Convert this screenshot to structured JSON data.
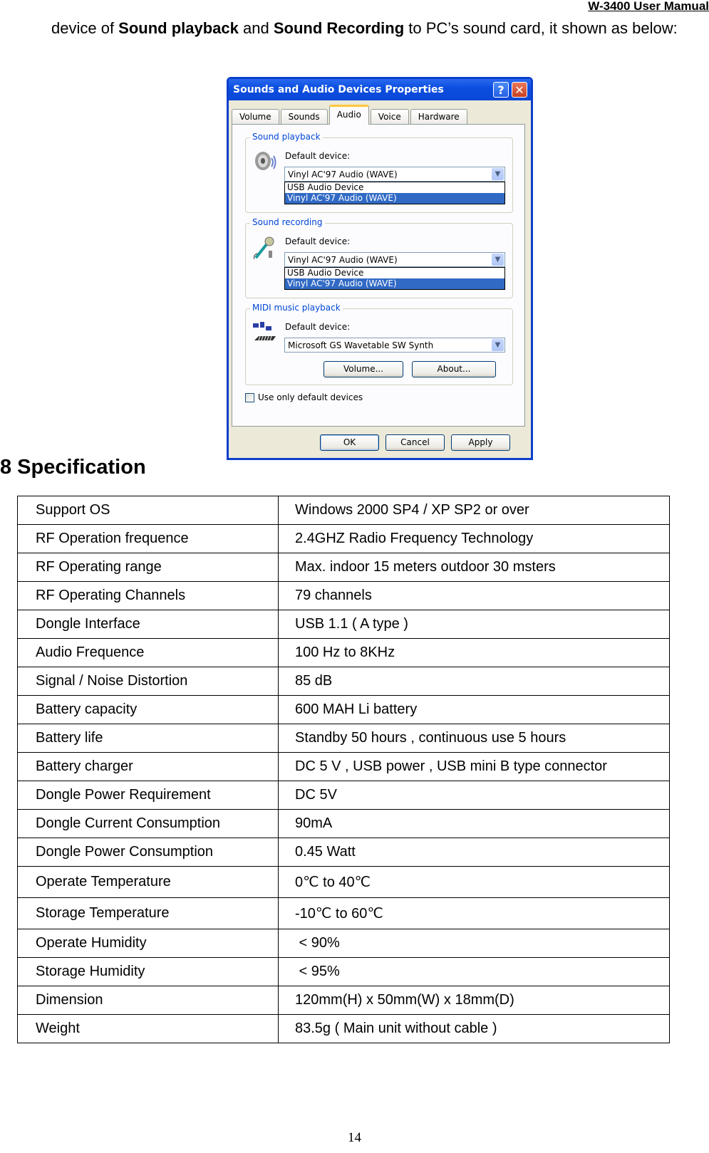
{
  "header": {
    "title": "W-3400 User Mamual"
  },
  "intro": {
    "prefix": "device of ",
    "bold1": "Sound playback",
    "mid": " and ",
    "bold2": "Sound Recording",
    "suffix": " to PC’s sound card, it shown as below:"
  },
  "dialog": {
    "title": "Sounds and Audio Devices Properties",
    "help_label": "?",
    "close_label": "✕",
    "tabs": [
      {
        "label": "Volume",
        "active": false
      },
      {
        "label": "Sounds",
        "active": false
      },
      {
        "label": "Audio",
        "active": true
      },
      {
        "label": "Voice",
        "active": false
      },
      {
        "label": "Hardware",
        "active": false
      }
    ],
    "groups": [
      {
        "legend": "Sound playback",
        "icon": "speaker-icon",
        "label": "Default device:",
        "selected": "Vinyl AC'97 Audio (WAVE)",
        "options": [
          "USB Audio Device",
          "Vinyl AC'97 Audio (WAVE)"
        ],
        "highlighted_option": "Vinyl AC'97 Audio (WAVE)"
      },
      {
        "legend": "Sound recording",
        "icon": "microphone-icon",
        "label": "Default device:",
        "selected": "Vinyl AC'97 Audio (WAVE)",
        "options": [
          "USB Audio Device",
          "Vinyl AC'97 Audio (WAVE)"
        ],
        "highlighted_option": "Vinyl AC'97 Audio (WAVE)"
      },
      {
        "legend": "MIDI music playback",
        "icon": "midi-keyboard-icon",
        "label": "Default device:",
        "selected": "Microsoft GS Wavetable SW Synth",
        "volume_button": "Volume...",
        "about_button": "About..."
      }
    ],
    "checkbox_label": "Use only default devices",
    "checkbox_checked": false,
    "ok_label": "OK",
    "cancel_label": "Cancel",
    "apply_label": "Apply"
  },
  "spec": {
    "heading": "8 Specification",
    "rows": [
      {
        "key": "Support OS",
        "value": "Windows 2000 SP4 / XP SP2 or over"
      },
      {
        "key": "RF Operation frequence",
        "value": "2.4GHZ Radio Frequency Technology"
      },
      {
        "key": "RF Operating range",
        "value": "Max. indoor 15 meters outdoor 30 msters"
      },
      {
        "key": "RF Operating Channels",
        "value": "79 channels"
      },
      {
        "key": "Dongle Interface",
        "value": "USB 1.1 ( A type )"
      },
      {
        "key": "Audio Frequence",
        "value": "100 Hz to 8KHz"
      },
      {
        "key": "Signal / Noise Distortion",
        "value": "85 dB"
      },
      {
        "key": "Battery capacity",
        "value": "600 MAH Li battery"
      },
      {
        "key": "Battery life",
        "value": "Standby 50 hours , continuous use 5 hours"
      },
      {
        "key": "Battery charger",
        "value": "DC 5 V , USB power , USB mini B type connector"
      },
      {
        "key": "Dongle Power Requirement",
        "value": "DC 5V"
      },
      {
        "key": "Dongle Current Consumption",
        "value": "90mA"
      },
      {
        "key": "Dongle Power Consumption",
        "value": "0.45 Watt"
      },
      {
        "key": "Operate Temperature",
        "value": "0℃ to 40℃"
      },
      {
        "key": "Storage Temperature",
        "value": "-10℃ to 60℃"
      },
      {
        "key": "Operate Humidity",
        "value": " < 90%"
      },
      {
        "key": "Storage Humidity",
        "value": " < 95%"
      },
      {
        "key": "Dimension",
        "value": "120mm(H) x 50mm(W) x 18mm(D)"
      },
      {
        "key": "Weight",
        "value": "83.5g ( Main unit without cable )"
      }
    ]
  },
  "footer": {
    "page_number": "14"
  }
}
